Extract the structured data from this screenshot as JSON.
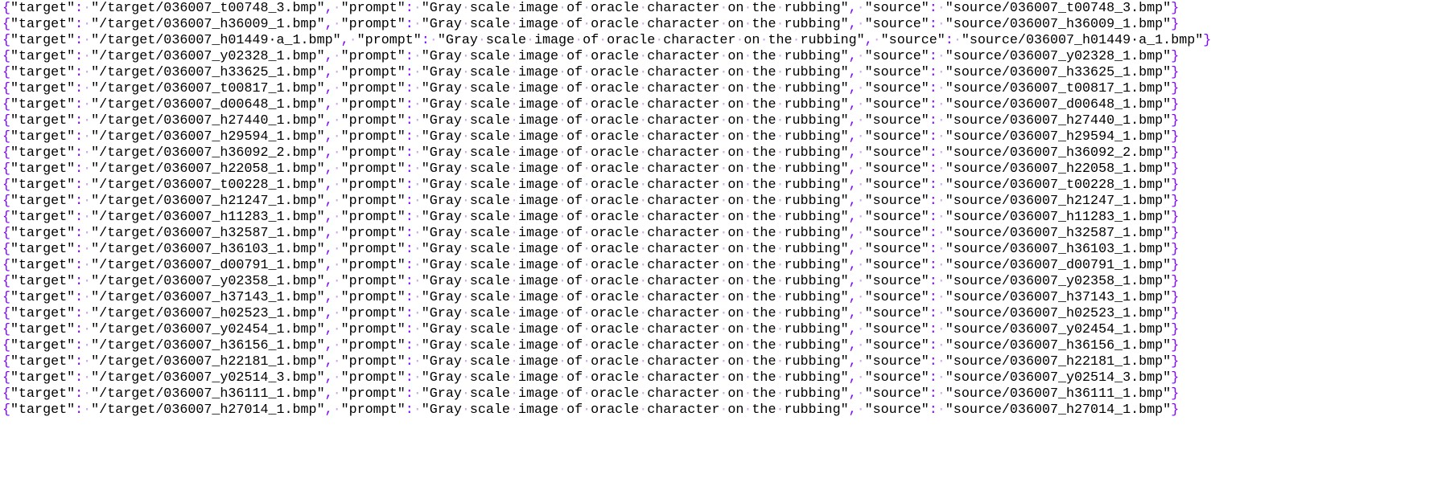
{
  "colors": {
    "text": "#000000",
    "punctuation": "#8000ff",
    "whitespace_marker": "#c9a6e8",
    "background": "#ffffff"
  },
  "editor": {
    "lines": [
      {
        "target": "/target/036007_t00748_3.bmp",
        "prompt": "Gray scale image of oracle character on the rubbing",
        "source": "source/036007_t00748_3.bmp"
      },
      {
        "target": "/target/036007_h36009_1.bmp",
        "prompt": "Gray scale image of oracle character on the rubbing",
        "source": "source/036007_h36009_1.bmp"
      },
      {
        "target": "/target/036007_h01449 a_1.bmp",
        "prompt": "Gray scale image of oracle character on the rubbing",
        "source": "source/036007_h01449 a_1.bmp"
      },
      {
        "target": "/target/036007_y02328_1.bmp",
        "prompt": "Gray scale image of oracle character on the rubbing",
        "source": "source/036007_y02328_1.bmp"
      },
      {
        "target": "/target/036007_h33625_1.bmp",
        "prompt": "Gray scale image of oracle character on the rubbing",
        "source": "source/036007_h33625_1.bmp"
      },
      {
        "target": "/target/036007_t00817_1.bmp",
        "prompt": "Gray scale image of oracle character on the rubbing",
        "source": "source/036007_t00817_1.bmp"
      },
      {
        "target": "/target/036007_d00648_1.bmp",
        "prompt": "Gray scale image of oracle character on the rubbing",
        "source": "source/036007_d00648_1.bmp"
      },
      {
        "target": "/target/036007_h27440_1.bmp",
        "prompt": "Gray scale image of oracle character on the rubbing",
        "source": "source/036007_h27440_1.bmp"
      },
      {
        "target": "/target/036007_h29594_1.bmp",
        "prompt": "Gray scale image of oracle character on the rubbing",
        "source": "source/036007_h29594_1.bmp"
      },
      {
        "target": "/target/036007_h36092_2.bmp",
        "prompt": "Gray scale image of oracle character on the rubbing",
        "source": "source/036007_h36092_2.bmp"
      },
      {
        "target": "/target/036007_h22058_1.bmp",
        "prompt": "Gray scale image of oracle character on the rubbing",
        "source": "source/036007_h22058_1.bmp"
      },
      {
        "target": "/target/036007_t00228_1.bmp",
        "prompt": "Gray scale image of oracle character on the rubbing",
        "source": "source/036007_t00228_1.bmp"
      },
      {
        "target": "/target/036007_h21247_1.bmp",
        "prompt": "Gray scale image of oracle character on the rubbing",
        "source": "source/036007_h21247_1.bmp"
      },
      {
        "target": "/target/036007_h11283_1.bmp",
        "prompt": "Gray scale image of oracle character on the rubbing",
        "source": "source/036007_h11283_1.bmp"
      },
      {
        "target": "/target/036007_h32587_1.bmp",
        "prompt": "Gray scale image of oracle character on the rubbing",
        "source": "source/036007_h32587_1.bmp"
      },
      {
        "target": "/target/036007_h36103_1.bmp",
        "prompt": "Gray scale image of oracle character on the rubbing",
        "source": "source/036007_h36103_1.bmp"
      },
      {
        "target": "/target/036007_d00791_1.bmp",
        "prompt": "Gray scale image of oracle character on the rubbing",
        "source": "source/036007_d00791_1.bmp"
      },
      {
        "target": "/target/036007_y02358_1.bmp",
        "prompt": "Gray scale image of oracle character on the rubbing",
        "source": "source/036007_y02358_1.bmp"
      },
      {
        "target": "/target/036007_h37143_1.bmp",
        "prompt": "Gray scale image of oracle character on the rubbing",
        "source": "source/036007_h37143_1.bmp"
      },
      {
        "target": "/target/036007_h02523_1.bmp",
        "prompt": "Gray scale image of oracle character on the rubbing",
        "source": "source/036007_h02523_1.bmp"
      },
      {
        "target": "/target/036007_y02454_1.bmp",
        "prompt": "Gray scale image of oracle character on the rubbing",
        "source": "source/036007_y02454_1.bmp"
      },
      {
        "target": "/target/036007_h36156_1.bmp",
        "prompt": "Gray scale image of oracle character on the rubbing",
        "source": "source/036007_h36156_1.bmp"
      },
      {
        "target": "/target/036007_h22181_1.bmp",
        "prompt": "Gray scale image of oracle character on the rubbing",
        "source": "source/036007_h22181_1.bmp"
      },
      {
        "target": "/target/036007_y02514_3.bmp",
        "prompt": "Gray scale image of oracle character on the rubbing",
        "source": "source/036007_y02514_3.bmp"
      },
      {
        "target": "/target/036007_h36111_1.bmp",
        "prompt": "Gray scale image of oracle character on the rubbing",
        "source": "source/036007_h36111_1.bmp"
      },
      {
        "target": "/target/036007_h27014_1.bmp",
        "prompt": "Gray scale image of oracle character on the rubbing",
        "source": "source/036007_h27014_1.bmp"
      }
    ]
  }
}
